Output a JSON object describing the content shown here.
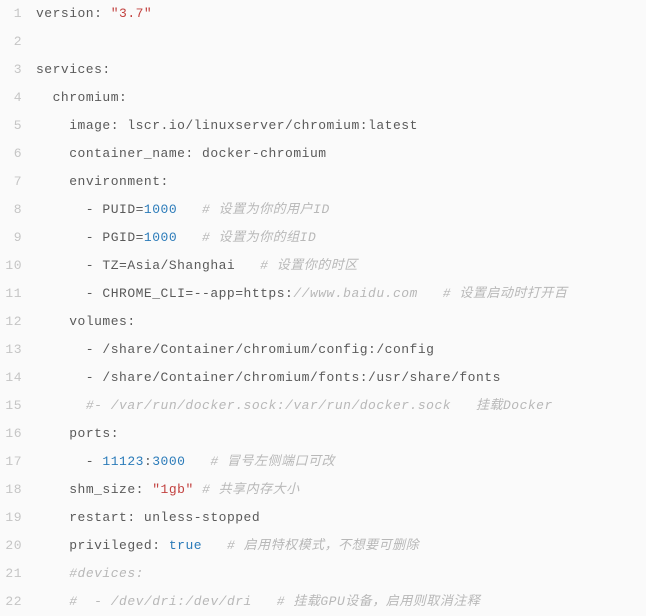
{
  "lines": [
    {
      "n": "1",
      "segs": [
        [
          "key",
          "version: "
        ],
        [
          "str",
          "\"3.7\""
        ]
      ]
    },
    {
      "n": "2",
      "segs": []
    },
    {
      "n": "3",
      "segs": [
        [
          "key",
          "services:"
        ]
      ]
    },
    {
      "n": "4",
      "segs": [
        [
          "plain",
          "  "
        ],
        [
          "key",
          "chromium:"
        ]
      ]
    },
    {
      "n": "5",
      "segs": [
        [
          "plain",
          "    "
        ],
        [
          "key",
          "image: lscr.io/linuxserver/chromium:latest"
        ]
      ]
    },
    {
      "n": "6",
      "segs": [
        [
          "plain",
          "    "
        ],
        [
          "key",
          "container_name: docker-chromium"
        ]
      ]
    },
    {
      "n": "7",
      "segs": [
        [
          "plain",
          "    "
        ],
        [
          "key",
          "environment:"
        ]
      ]
    },
    {
      "n": "8",
      "segs": [
        [
          "plain",
          "      - PUID="
        ],
        [
          "num",
          "1000"
        ],
        [
          "plain",
          "   "
        ],
        [
          "comment",
          "# 设置为你的用户ID"
        ]
      ]
    },
    {
      "n": "9",
      "segs": [
        [
          "plain",
          "      - PGID="
        ],
        [
          "num",
          "1000"
        ],
        [
          "plain",
          "   "
        ],
        [
          "comment",
          "# 设置为你的组ID"
        ]
      ]
    },
    {
      "n": "10",
      "segs": [
        [
          "plain",
          "      - TZ=Asia/Shanghai   "
        ],
        [
          "comment",
          "# 设置你的时区"
        ]
      ]
    },
    {
      "n": "11",
      "segs": [
        [
          "plain",
          "      - CHROME_CLI=--app=https:"
        ],
        [
          "comment",
          "//www.baidu.com   # 设置启动时打开百"
        ]
      ]
    },
    {
      "n": "12",
      "segs": [
        [
          "plain",
          "    "
        ],
        [
          "key",
          "volumes:"
        ]
      ]
    },
    {
      "n": "13",
      "segs": [
        [
          "plain",
          "      - /share/Container/chromium/config:/config"
        ]
      ]
    },
    {
      "n": "14",
      "segs": [
        [
          "plain",
          "      - /share/Container/chromium/fonts:/usr/share/fonts"
        ]
      ]
    },
    {
      "n": "15",
      "segs": [
        [
          "plain",
          "      "
        ],
        [
          "comment",
          "#- /var/run/docker.sock:/var/run/docker.sock   挂载Docker"
        ]
      ]
    },
    {
      "n": "16",
      "segs": [
        [
          "plain",
          "    "
        ],
        [
          "key",
          "ports:"
        ]
      ]
    },
    {
      "n": "17",
      "segs": [
        [
          "plain",
          "      - "
        ],
        [
          "num",
          "11123"
        ],
        [
          "plain",
          ":"
        ],
        [
          "num",
          "3000"
        ],
        [
          "plain",
          "   "
        ],
        [
          "comment",
          "# 冒号左侧端口可改"
        ]
      ]
    },
    {
      "n": "18",
      "segs": [
        [
          "plain",
          "    "
        ],
        [
          "key",
          "shm_size: "
        ],
        [
          "str",
          "\"1gb\""
        ],
        [
          "plain",
          " "
        ],
        [
          "comment",
          "# 共享内存大小"
        ]
      ]
    },
    {
      "n": "19",
      "segs": [
        [
          "plain",
          "    "
        ],
        [
          "key",
          "restart: unless-stopped"
        ]
      ]
    },
    {
      "n": "20",
      "segs": [
        [
          "plain",
          "    "
        ],
        [
          "key",
          "privileged: "
        ],
        [
          "bool",
          "true"
        ],
        [
          "plain",
          "   "
        ],
        [
          "comment",
          "# 启用特权模式，不想要可删除"
        ]
      ]
    },
    {
      "n": "21",
      "segs": [
        [
          "plain",
          "    "
        ],
        [
          "comment",
          "#devices:"
        ]
      ]
    },
    {
      "n": "22",
      "segs": [
        [
          "plain",
          "    "
        ],
        [
          "comment",
          "#  - /dev/dri:/dev/dri   # 挂载GPU设备，启用则取消注释"
        ]
      ]
    }
  ]
}
